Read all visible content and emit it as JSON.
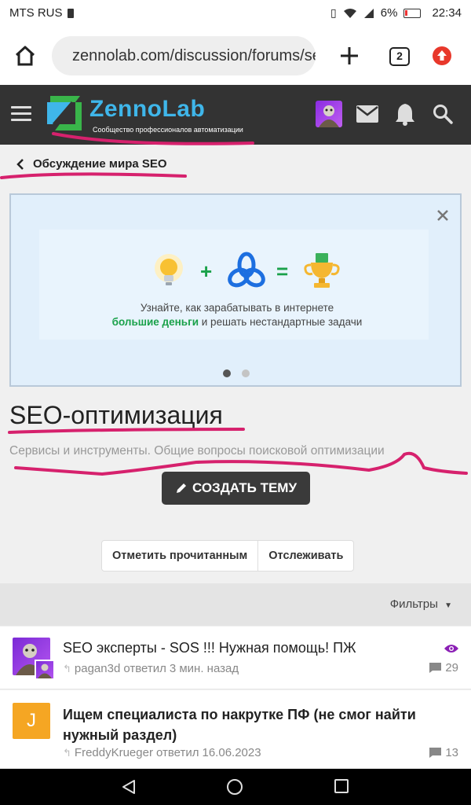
{
  "status_bar": {
    "carrier": "MTS RUS",
    "battery": "6%",
    "time": "22:34"
  },
  "browser": {
    "url": "zennolab.com/discussion/forums/seo",
    "tab_count": "2"
  },
  "header": {
    "logo_text": "ZennoLab",
    "logo_subtitle": "Сообщество профессионалов автоматизации"
  },
  "breadcrumb": {
    "label": "Обсуждение мира SEO"
  },
  "banner": {
    "line1": "Узнайте, как зарабатывать в интернете",
    "line2_highlight": "большие деньги",
    "line2_rest": " и решать нестандартные задачи",
    "active_slide": 1,
    "slide_count": 2
  },
  "forum": {
    "title": "SEO-оптимизация",
    "description": "Сервисы и инструменты. Общие вопросы поисковой оптимизации",
    "create_button": "СОЗДАТЬ ТЕМУ",
    "mark_read_button": "Отметить прочитанным",
    "watch_button": "Отслеживать",
    "filters_label": "Фильтры"
  },
  "threads": [
    {
      "title": "SEO эксперты - SOS !!! Нужная помощь! ПЖ",
      "author": "pagan3d",
      "action": "ответил",
      "time": "3 мин. назад",
      "replies": "29",
      "watched": true
    },
    {
      "title": "Ищем специалиста по накрутке ПФ (не смог найти нужный раздел)",
      "author": "FreddyKrueger",
      "action": "ответил",
      "time": "16.06.2023",
      "replies": "13",
      "avatar_letter": "J",
      "watched": false
    }
  ],
  "colors": {
    "header_bg": "#333333",
    "logo_blue": "#3fb6ea",
    "logo_green": "#39b54a",
    "highlight_green": "#1aa14a",
    "marker": "#d6216d",
    "watch_purple": "#8b1fb5",
    "avatar_orange": "#f5a623"
  }
}
